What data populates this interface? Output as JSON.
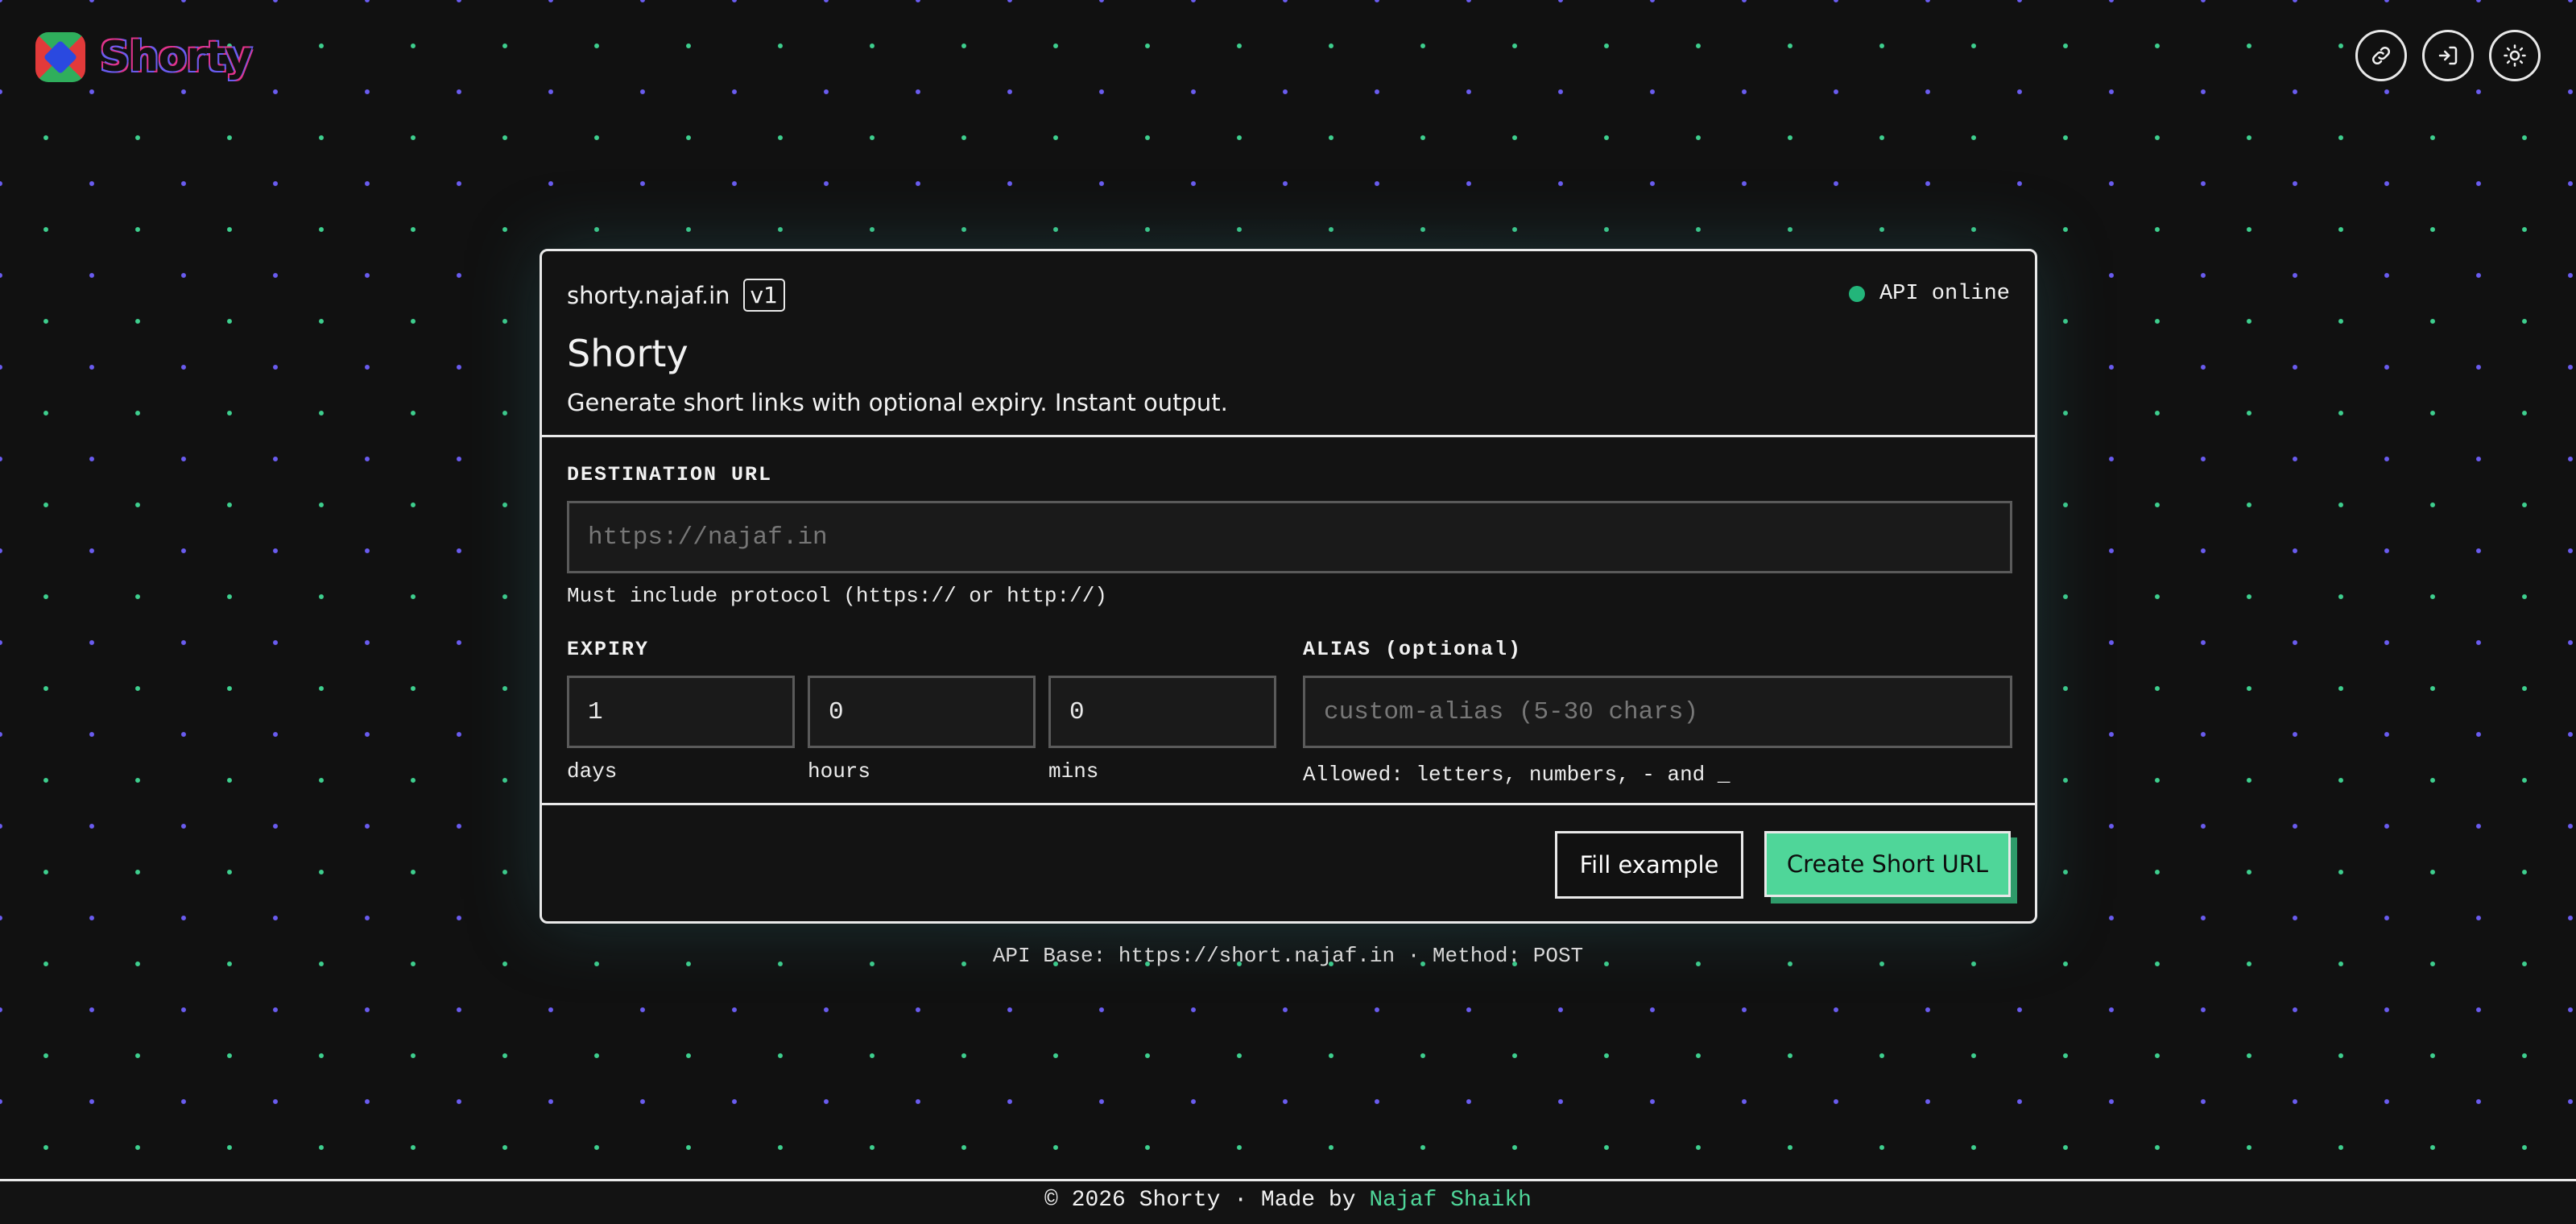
{
  "header": {
    "brand": "Shorty",
    "icons": [
      "link-icon",
      "login-icon",
      "sun-icon"
    ]
  },
  "card": {
    "domain": "shorty.najaf.in",
    "version": "v1",
    "status": "API online",
    "title": "Shorty",
    "subtitle": "Generate short links with optional expiry. Instant output.",
    "destination": {
      "label": "DESTINATION URL",
      "placeholder": "https://najaf.in",
      "hint": "Must include protocol (https:// or http://)"
    },
    "expiry": {
      "label": "EXPIRY",
      "days_value": "1",
      "hours_value": "0",
      "mins_value": "0",
      "days_label": "days",
      "hours_label": "hours",
      "mins_label": "mins"
    },
    "alias": {
      "label": "ALIAS (optional)",
      "placeholder": "custom-alias (5-30 chars)",
      "hint": "Allowed: letters, numbers, - and _"
    },
    "buttons": {
      "fill_example": "Fill example",
      "create": "Create Short URL"
    }
  },
  "api_base": "API Base: https://short.najaf.in · Method: POST",
  "footer": {
    "text": "© 2026 Shorty · Made by ",
    "author": "Najaf Shaikh"
  },
  "colors": {
    "accent": "#4fd699",
    "status_dot": "#23b57a",
    "background": "#111111",
    "dot_green": "#3ecf8e",
    "dot_purple": "#6a5cf0"
  }
}
